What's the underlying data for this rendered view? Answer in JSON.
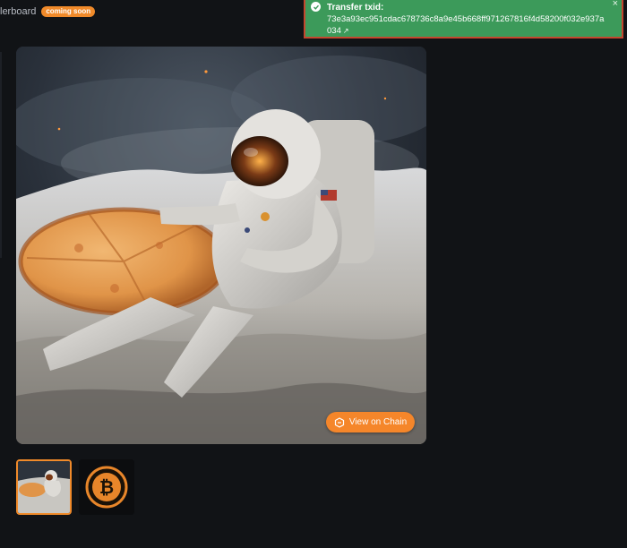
{
  "nav": {
    "leaderboard_label": "lerboard",
    "coming_soon_badge": "coming soon"
  },
  "image": {
    "view_on_chain_label": "View on Chain"
  },
  "thumbnails": [
    {
      "name": "astronaut-pizza-thumb",
      "selected": true
    },
    {
      "name": "bitcoin-coin-thumb",
      "selected": false
    }
  ],
  "toast": {
    "title": "Transfer txid:",
    "txid": "73e3a93ec951cdac678736c8a9e45b668ff971267816f4d58200f032e937a034",
    "close_symbol": "×",
    "link_symbol": "↗",
    "status_color": "#3c9a5a"
  },
  "colors": {
    "accent": "#f08a2a",
    "background": "#111316"
  }
}
